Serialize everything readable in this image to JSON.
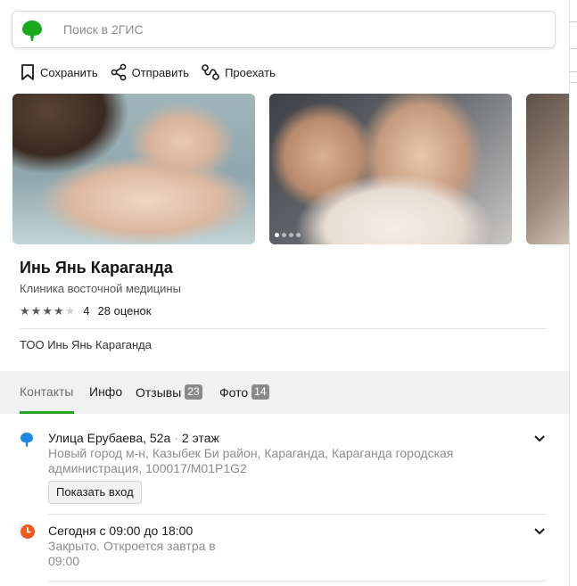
{
  "search": {
    "placeholder": "Поиск в 2ГИС"
  },
  "actions": {
    "save": "Сохранить",
    "share": "Отправить",
    "route": "Проехать"
  },
  "org": {
    "name": "Инь Янь Караганда",
    "category": "Клиника восточной медицины",
    "rating_score": "4",
    "rating_count": "28 оценок",
    "rating_stars": 4,
    "legal_name": "ТОО Инь Янь Караганда"
  },
  "tabs": {
    "contacts": "Контакты",
    "info": "Инфо",
    "reviews": "Отзывы",
    "reviews_count": "23",
    "photos": "Фото",
    "photos_count": "14"
  },
  "address": {
    "street": "Улица Ерубаева, 52а",
    "floor": "2 этаж",
    "details": "Новый город м-н, Казыбек Би район, Караганда, Караганда городская администрация, 100017/M01P1G2",
    "entrance_button": "Показать вход"
  },
  "hours": {
    "today": "Сегодня с 09:00 до 18:00",
    "status": "Закрыто. Откроется завтра в 09:00"
  },
  "colors": {
    "brand_green": "#29a329",
    "address_pin": "#1e88e5",
    "clock_orange": "#f2581d"
  }
}
